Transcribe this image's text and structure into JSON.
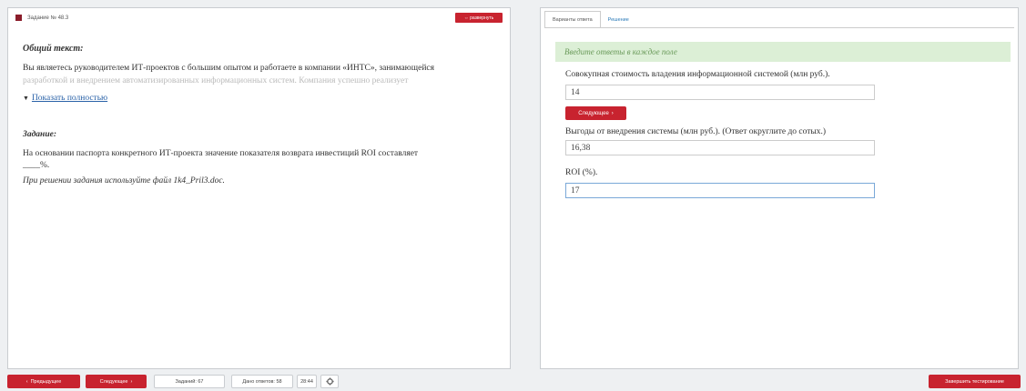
{
  "task": {
    "header": "Задание № 48.3",
    "expand_label": "⇔ развернуть",
    "common_label": "Общий текст:",
    "common_text_main": "Вы являетесь руководителем ИТ-проектов с большим опытом и работаете в компании «ИНТС», занимающейся",
    "common_text_faded": "разработкой и внедрением автоматизированных информационных систем. Компания успешно реализует",
    "show_more_icon": "▼",
    "show_more": "Показать полностью",
    "task_label": "Задание:",
    "task_text": "На основании паспорта конкретного ИТ-проекта значение показателя возврата инвестиций ROI составляет",
    "task_blank": "____%.",
    "task_hint": "При решении задания используйте файл 1k4_Pril3.doc."
  },
  "answer": {
    "tabs": [
      "Варианты ответа",
      "Решение"
    ],
    "hint": "Введите ответы в каждое поле",
    "questions": [
      {
        "label": "Совокупная стоимость владения информационной системой (млн руб.).",
        "value": "14"
      },
      {
        "label": "Выгоды от внедрения системы (млн руб.). (Ответ округлите до сотых.)",
        "value": "16,38"
      },
      {
        "label": "ROI (%).",
        "value": "17"
      }
    ],
    "next_label": "Следующее",
    "next_icon": "›"
  },
  "bottom": {
    "prev_icon": "‹",
    "prev_label": "Предыдущее",
    "next_label": "Следующее",
    "next_icon": "›",
    "tasks_count": "Заданий: 67",
    "answers_count": "Дано ответов: 58",
    "timer": "28:44",
    "settings_icon": "gear-icon",
    "finish_label": "Завершить тестирование"
  },
  "colors": {
    "accent_red": "#c8232f",
    "hint_green_bg": "#dcefd6",
    "link_blue": "#2a62a8"
  }
}
